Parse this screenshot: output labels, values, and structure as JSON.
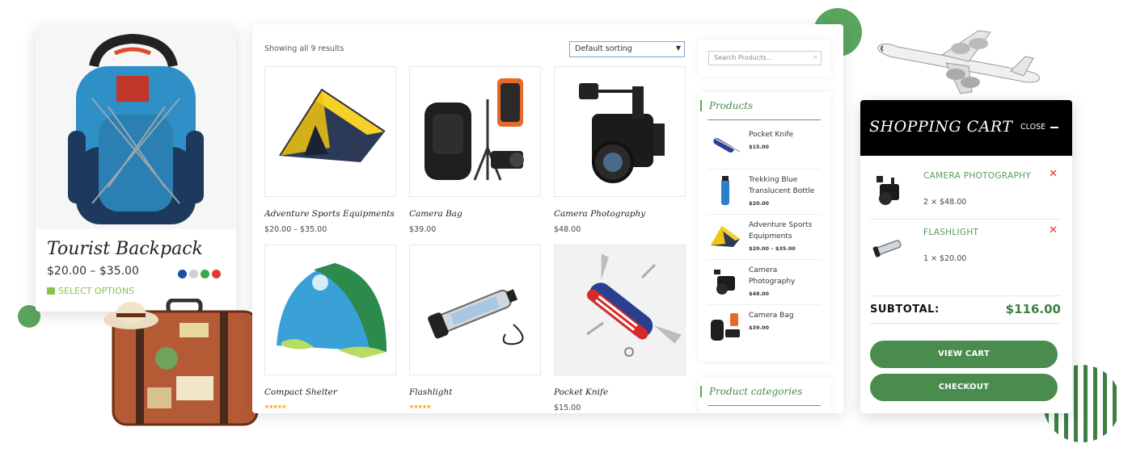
{
  "product_card": {
    "title": "Tourist Backpack",
    "price": "$20.00 – $35.00",
    "select_options": "SELECT OPTIONS",
    "swatches": [
      "#1e4fa8",
      "#cfcfcf",
      "#3aa849",
      "#e03b2e"
    ]
  },
  "shop": {
    "result_count": "Showing all 9 results",
    "sort_selected": "Default sorting",
    "products": [
      {
        "name": "Adventure Sports Equipments",
        "price": "$20.00 – $35.00",
        "image": "tent-icon"
      },
      {
        "name": "Camera Bag",
        "price": "$39.00",
        "image": "camera-bag-icon"
      },
      {
        "name": "Camera Photography",
        "price": "$48.00",
        "image": "camera-icon"
      },
      {
        "name": "Compact Shelter",
        "stars": "★★★★★",
        "image": "shelter-icon"
      },
      {
        "name": "Flashlight",
        "stars": "★★★★★",
        "image": "flashlight-icon"
      },
      {
        "name": "Pocket Knife",
        "price": "$15.00",
        "image": "knife-icon"
      }
    ]
  },
  "sidebar": {
    "search_placeholder": "Search Products...",
    "products_title": "Products",
    "products": [
      {
        "name": "Pocket Knife",
        "price": "$15.00"
      },
      {
        "name": "Trekking Blue Translucent Bottle",
        "price": "$20.00"
      },
      {
        "name": "Adventure Sports Equipments",
        "price": "$20.00 – $35.00"
      },
      {
        "name": "Camera Photography",
        "price": "$48.00"
      },
      {
        "name": "Camera Bag",
        "price": "$39.00"
      }
    ],
    "categories_title": "Product categories"
  },
  "cart": {
    "title": "SHOPPING CART",
    "close_label": "CLOSE",
    "items": [
      {
        "name": "CAMERA PHOTOGRAPHY",
        "qty": "2 × $48.00"
      },
      {
        "name": "FLASHLIGHT",
        "qty": "1 × $20.00"
      }
    ],
    "subtotal_label": "SUBTOTAL:",
    "subtotal_value": "$116.00",
    "view_cart": "VIEW CART",
    "checkout": "CHECKOUT"
  },
  "colors": {
    "accent": "#4a8c4e",
    "remove": "#dd3333",
    "stars": "#f5a623"
  }
}
